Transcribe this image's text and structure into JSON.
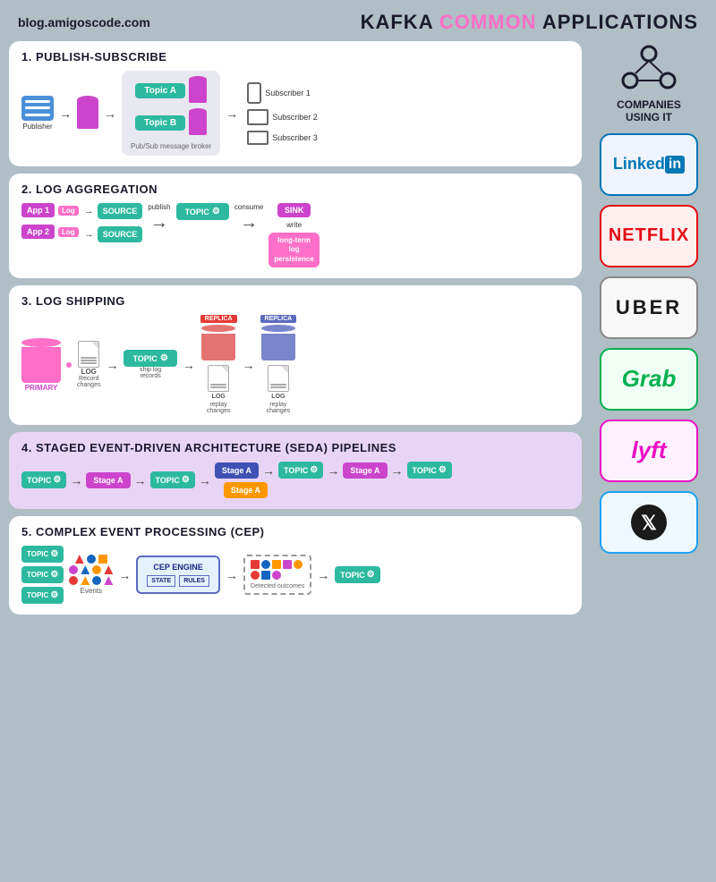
{
  "header": {
    "blog_url": "blog.amigoscode.com",
    "title_part1": "KAFKA ",
    "title_part2": "COMMON",
    "title_part3": " APPLICATIONS"
  },
  "panels": {
    "pubsub": {
      "title": "1. PUBLISH-SUBSCRIBE",
      "publisher_label": "Publisher",
      "broker_label": "Pub/Sub message broker",
      "topic_a": "Topic A",
      "topic_b": "Topic B",
      "sub1": "Subscriber 1",
      "sub2": "Subscriber 2",
      "sub3": "Subscriber 3"
    },
    "log_agg": {
      "title": "2. LOG AGGREGATION",
      "app1": "App 1",
      "app2": "App 2",
      "log": "Log",
      "source": "SOURCE",
      "publish": "publish",
      "consume": "consume",
      "topic": "TOPIC",
      "sink": "SINK",
      "write": "write",
      "persistence": "long-term\nlog\npersistence"
    },
    "log_ship": {
      "title": "3. LOG SHIPPING",
      "primary": "PRIMARY",
      "record_changes": "Record\nchanges",
      "log": "LOG",
      "topic": "TOPIC",
      "ship_label": "ship log\nrecords",
      "replica1": "REPLICA",
      "replica2": "REPLICA",
      "replay1": "replay\nchanges",
      "replay2": "replay\nchanges"
    },
    "seda": {
      "title": "4. STAGED EVENT-DRIVEN ARCHITECTURE (SEDA) PIPELINES",
      "stage_a": "Stage A",
      "topic": "TOPIC"
    },
    "cep": {
      "title": "5. COMPLEX EVENT PROCESSING (CEP)",
      "topic": "TOPIC",
      "events": "Events",
      "cep_engine": "CEP ENGINE",
      "state": "STATE",
      "rules": "RULES",
      "detected": "Detected outcomes"
    }
  },
  "sidebar": {
    "companies_label": "COMPANIES\nUSING IT",
    "companies": [
      {
        "name": "LinkedIn",
        "type": "linkedin"
      },
      {
        "name": "Netflix",
        "type": "netflix"
      },
      {
        "name": "Uber",
        "type": "uber"
      },
      {
        "name": "Grab",
        "type": "grab"
      },
      {
        "name": "Lyft",
        "type": "lyft"
      },
      {
        "name": "X (Twitter)",
        "type": "twitter"
      }
    ]
  },
  "colors": {
    "teal": "#2db9a0",
    "pink": "#ff6ec7",
    "purple": "#cc44cc",
    "orange": "#ff9800",
    "blue": "#3f51b5",
    "dark_blue": "#1a237e",
    "red": "#e53935"
  }
}
